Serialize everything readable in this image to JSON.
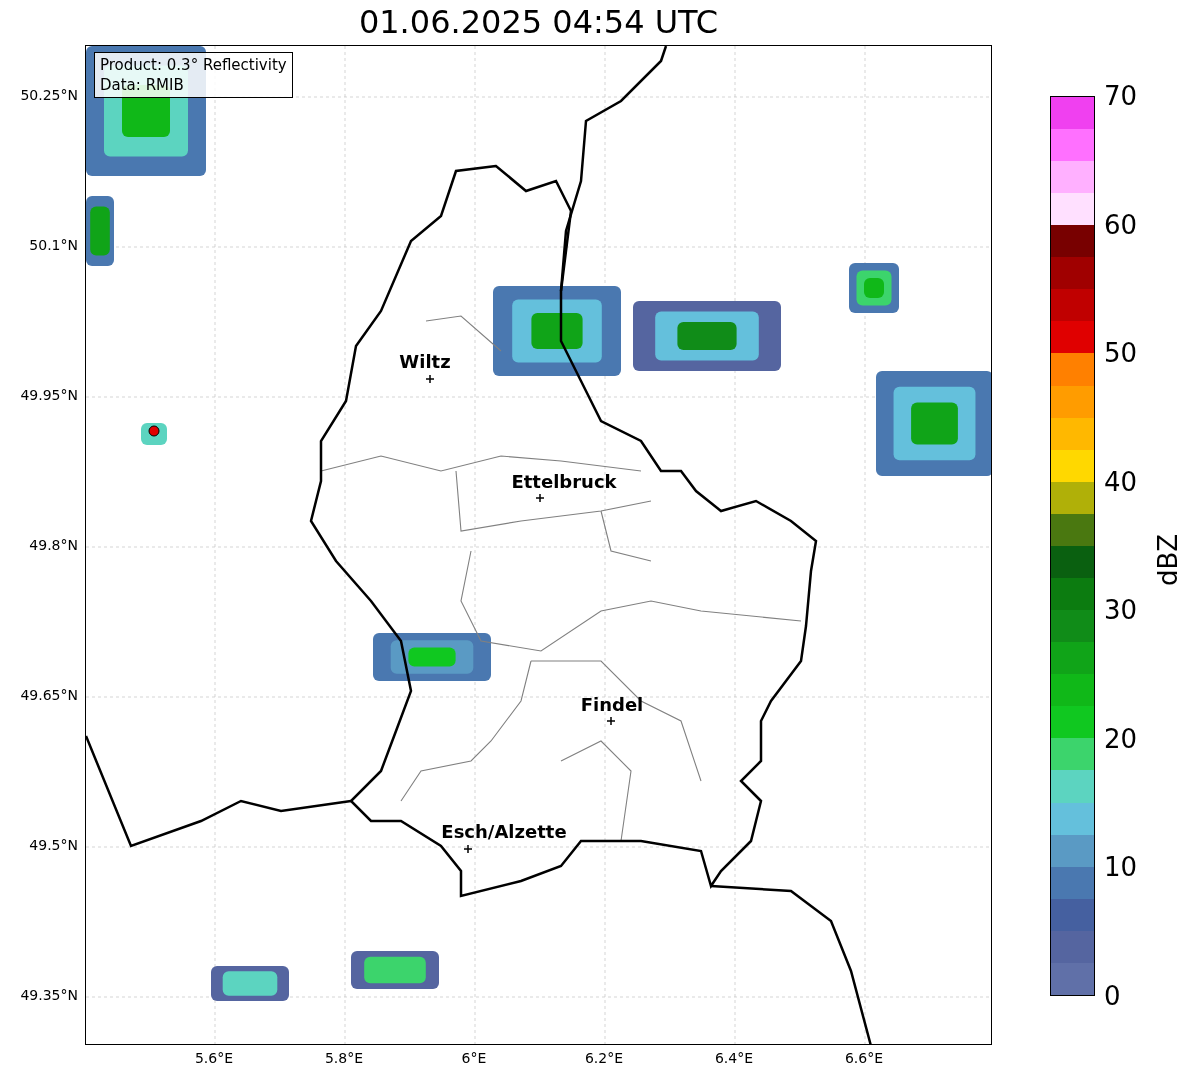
{
  "title": "01.06.2025 04:54 UTC",
  "legend": [
    "Product: 0.3° Reflectivity",
    "Data: RMIB"
  ],
  "lat_ticks": [
    "50.25°N",
    "50.1°N",
    "49.95°N",
    "49.8°N",
    "49.65°N",
    "49.5°N",
    "49.35°N"
  ],
  "lon_ticks": [
    "5.6°E",
    "5.8°E",
    "6°E",
    "6.2°E",
    "6.4°E",
    "6.6°E"
  ],
  "cities": [
    {
      "name": "Wiltz"
    },
    {
      "name": "Ettelbruck"
    },
    {
      "name": "Findel"
    },
    {
      "name": "Esch/Alzette"
    }
  ],
  "colorbar": {
    "label": "dBZ",
    "ticks": [
      "70",
      "60",
      "50",
      "40",
      "30",
      "20",
      "10",
      "0"
    ],
    "segments": [
      {
        "color": "#6070a8"
      },
      {
        "color": "#5565a0"
      },
      {
        "color": "#4560a0"
      },
      {
        "color": "#4a78b0"
      },
      {
        "color": "#5a9ac4"
      },
      {
        "color": "#64c0dc"
      },
      {
        "color": "#5cd4c0"
      },
      {
        "color": "#3cd46c"
      },
      {
        "color": "#10c820"
      },
      {
        "color": "#10b818"
      },
      {
        "color": "#10a418"
      },
      {
        "color": "#108c18"
      },
      {
        "color": "#0c7c10"
      },
      {
        "color": "#0a6010"
      },
      {
        "color": "#4a7810"
      },
      {
        "color": "#b0b008"
      },
      {
        "color": "#ffd800"
      },
      {
        "color": "#ffb800"
      },
      {
        "color": "#ff9c00"
      },
      {
        "color": "#ff8000"
      },
      {
        "color": "#e00000"
      },
      {
        "color": "#c00000"
      },
      {
        "color": "#a00000"
      },
      {
        "color": "#780000"
      },
      {
        "color": "#ffe0ff"
      },
      {
        "color": "#ffb0ff"
      },
      {
        "color": "#ff70ff"
      },
      {
        "color": "#f040f0"
      }
    ]
  }
}
